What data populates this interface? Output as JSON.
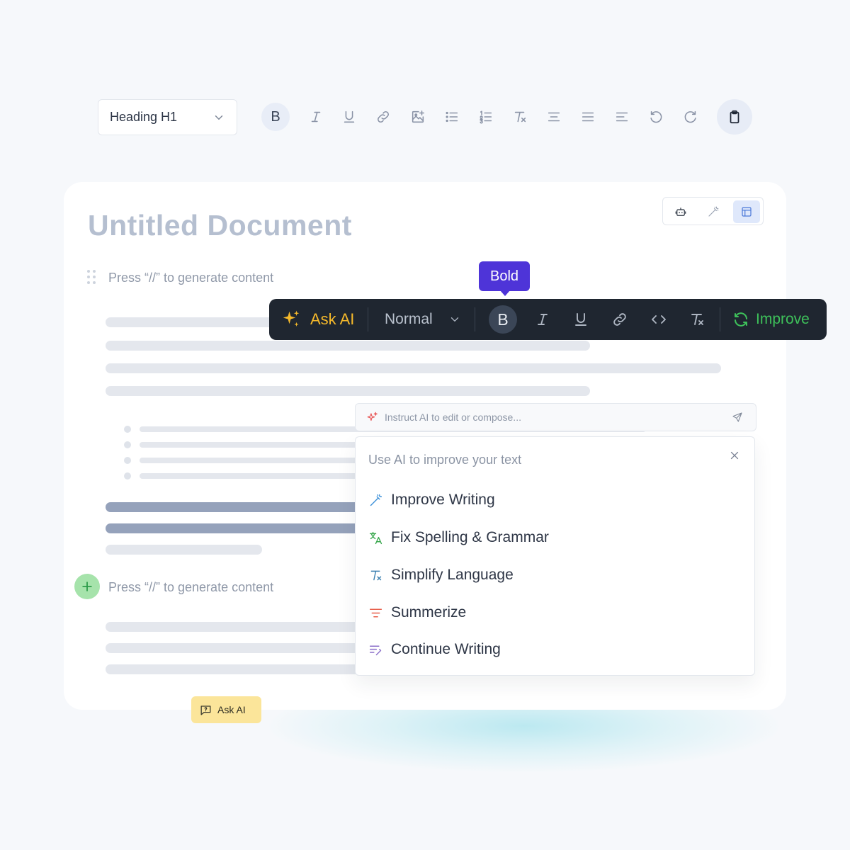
{
  "toolbar": {
    "heading_select": "Heading H1",
    "bold_glyph": "B"
  },
  "document": {
    "title": "Untitled Document",
    "prompt_placeholder_1": "Press “//” to generate content",
    "prompt_placeholder_2": "Press “//” to generate content",
    "view_modes": [
      "robot-icon",
      "magic-wand-icon",
      "layout-icon"
    ],
    "active_view": "layout-icon"
  },
  "float_toolbar": {
    "ask_ai": "Ask AI",
    "text_style": "Normal",
    "bold_glyph": "B",
    "tooltip": "Bold",
    "improve": "Improve"
  },
  "ai_input": {
    "placeholder": "Instruct AI to edit or compose..."
  },
  "ai_menu": {
    "heading": "Use AI to improve your text",
    "items": [
      {
        "label": "Improve Writing",
        "icon": "magic-wand-icon",
        "color": "#3a8fd8"
      },
      {
        "label": "Fix Spelling & Grammar",
        "icon": "translate-icon",
        "color": "#3aa84e"
      },
      {
        "label": "Simplify Language",
        "icon": "clear-format-icon",
        "color": "#3a7fb0"
      },
      {
        "label": "Summerize",
        "icon": "summary-icon",
        "color": "#e8604c"
      },
      {
        "label": "Continue Writing",
        "icon": "continue-writing-icon",
        "color": "#8b6fc9"
      }
    ]
  },
  "ask_chip": {
    "label": "Ask AI"
  },
  "colors": {
    "accent": "#4e34d8",
    "ask_ai": "#f5b92b",
    "improve": "#3ec15a",
    "toolbar_bg": "#1f2630"
  }
}
